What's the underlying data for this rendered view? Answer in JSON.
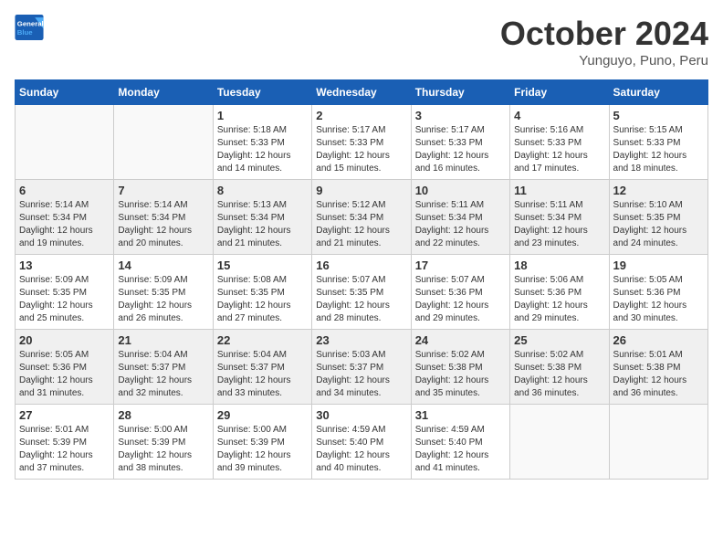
{
  "header": {
    "logo_general": "General",
    "logo_blue": "Blue",
    "month_title": "October 2024",
    "location": "Yunguyo, Puno, Peru"
  },
  "weekdays": [
    "Sunday",
    "Monday",
    "Tuesday",
    "Wednesday",
    "Thursday",
    "Friday",
    "Saturday"
  ],
  "weeks": [
    [
      {
        "day": "",
        "sunrise": "",
        "sunset": "",
        "daylight": ""
      },
      {
        "day": "",
        "sunrise": "",
        "sunset": "",
        "daylight": ""
      },
      {
        "day": "1",
        "sunrise": "Sunrise: 5:18 AM",
        "sunset": "Sunset: 5:33 PM",
        "daylight": "Daylight: 12 hours and 14 minutes."
      },
      {
        "day": "2",
        "sunrise": "Sunrise: 5:17 AM",
        "sunset": "Sunset: 5:33 PM",
        "daylight": "Daylight: 12 hours and 15 minutes."
      },
      {
        "day": "3",
        "sunrise": "Sunrise: 5:17 AM",
        "sunset": "Sunset: 5:33 PM",
        "daylight": "Daylight: 12 hours and 16 minutes."
      },
      {
        "day": "4",
        "sunrise": "Sunrise: 5:16 AM",
        "sunset": "Sunset: 5:33 PM",
        "daylight": "Daylight: 12 hours and 17 minutes."
      },
      {
        "day": "5",
        "sunrise": "Sunrise: 5:15 AM",
        "sunset": "Sunset: 5:33 PM",
        "daylight": "Daylight: 12 hours and 18 minutes."
      }
    ],
    [
      {
        "day": "6",
        "sunrise": "Sunrise: 5:14 AM",
        "sunset": "Sunset: 5:34 PM",
        "daylight": "Daylight: 12 hours and 19 minutes."
      },
      {
        "day": "7",
        "sunrise": "Sunrise: 5:14 AM",
        "sunset": "Sunset: 5:34 PM",
        "daylight": "Daylight: 12 hours and 20 minutes."
      },
      {
        "day": "8",
        "sunrise": "Sunrise: 5:13 AM",
        "sunset": "Sunset: 5:34 PM",
        "daylight": "Daylight: 12 hours and 21 minutes."
      },
      {
        "day": "9",
        "sunrise": "Sunrise: 5:12 AM",
        "sunset": "Sunset: 5:34 PM",
        "daylight": "Daylight: 12 hours and 21 minutes."
      },
      {
        "day": "10",
        "sunrise": "Sunrise: 5:11 AM",
        "sunset": "Sunset: 5:34 PM",
        "daylight": "Daylight: 12 hours and 22 minutes."
      },
      {
        "day": "11",
        "sunrise": "Sunrise: 5:11 AM",
        "sunset": "Sunset: 5:34 PM",
        "daylight": "Daylight: 12 hours and 23 minutes."
      },
      {
        "day": "12",
        "sunrise": "Sunrise: 5:10 AM",
        "sunset": "Sunset: 5:35 PM",
        "daylight": "Daylight: 12 hours and 24 minutes."
      }
    ],
    [
      {
        "day": "13",
        "sunrise": "Sunrise: 5:09 AM",
        "sunset": "Sunset: 5:35 PM",
        "daylight": "Daylight: 12 hours and 25 minutes."
      },
      {
        "day": "14",
        "sunrise": "Sunrise: 5:09 AM",
        "sunset": "Sunset: 5:35 PM",
        "daylight": "Daylight: 12 hours and 26 minutes."
      },
      {
        "day": "15",
        "sunrise": "Sunrise: 5:08 AM",
        "sunset": "Sunset: 5:35 PM",
        "daylight": "Daylight: 12 hours and 27 minutes."
      },
      {
        "day": "16",
        "sunrise": "Sunrise: 5:07 AM",
        "sunset": "Sunset: 5:35 PM",
        "daylight": "Daylight: 12 hours and 28 minutes."
      },
      {
        "day": "17",
        "sunrise": "Sunrise: 5:07 AM",
        "sunset": "Sunset: 5:36 PM",
        "daylight": "Daylight: 12 hours and 29 minutes."
      },
      {
        "day": "18",
        "sunrise": "Sunrise: 5:06 AM",
        "sunset": "Sunset: 5:36 PM",
        "daylight": "Daylight: 12 hours and 29 minutes."
      },
      {
        "day": "19",
        "sunrise": "Sunrise: 5:05 AM",
        "sunset": "Sunset: 5:36 PM",
        "daylight": "Daylight: 12 hours and 30 minutes."
      }
    ],
    [
      {
        "day": "20",
        "sunrise": "Sunrise: 5:05 AM",
        "sunset": "Sunset: 5:36 PM",
        "daylight": "Daylight: 12 hours and 31 minutes."
      },
      {
        "day": "21",
        "sunrise": "Sunrise: 5:04 AM",
        "sunset": "Sunset: 5:37 PM",
        "daylight": "Daylight: 12 hours and 32 minutes."
      },
      {
        "day": "22",
        "sunrise": "Sunrise: 5:04 AM",
        "sunset": "Sunset: 5:37 PM",
        "daylight": "Daylight: 12 hours and 33 minutes."
      },
      {
        "day": "23",
        "sunrise": "Sunrise: 5:03 AM",
        "sunset": "Sunset: 5:37 PM",
        "daylight": "Daylight: 12 hours and 34 minutes."
      },
      {
        "day": "24",
        "sunrise": "Sunrise: 5:02 AM",
        "sunset": "Sunset: 5:38 PM",
        "daylight": "Daylight: 12 hours and 35 minutes."
      },
      {
        "day": "25",
        "sunrise": "Sunrise: 5:02 AM",
        "sunset": "Sunset: 5:38 PM",
        "daylight": "Daylight: 12 hours and 36 minutes."
      },
      {
        "day": "26",
        "sunrise": "Sunrise: 5:01 AM",
        "sunset": "Sunset: 5:38 PM",
        "daylight": "Daylight: 12 hours and 36 minutes."
      }
    ],
    [
      {
        "day": "27",
        "sunrise": "Sunrise: 5:01 AM",
        "sunset": "Sunset: 5:39 PM",
        "daylight": "Daylight: 12 hours and 37 minutes."
      },
      {
        "day": "28",
        "sunrise": "Sunrise: 5:00 AM",
        "sunset": "Sunset: 5:39 PM",
        "daylight": "Daylight: 12 hours and 38 minutes."
      },
      {
        "day": "29",
        "sunrise": "Sunrise: 5:00 AM",
        "sunset": "Sunset: 5:39 PM",
        "daylight": "Daylight: 12 hours and 39 minutes."
      },
      {
        "day": "30",
        "sunrise": "Sunrise: 4:59 AM",
        "sunset": "Sunset: 5:40 PM",
        "daylight": "Daylight: 12 hours and 40 minutes."
      },
      {
        "day": "31",
        "sunrise": "Sunrise: 4:59 AM",
        "sunset": "Sunset: 5:40 PM",
        "daylight": "Daylight: 12 hours and 41 minutes."
      },
      {
        "day": "",
        "sunrise": "",
        "sunset": "",
        "daylight": ""
      },
      {
        "day": "",
        "sunrise": "",
        "sunset": "",
        "daylight": ""
      }
    ]
  ]
}
